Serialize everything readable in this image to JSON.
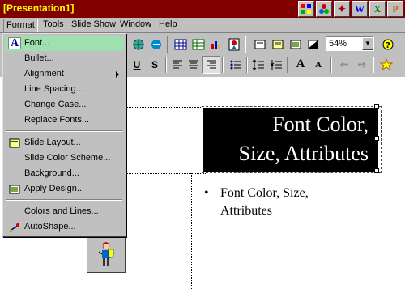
{
  "window": {
    "title": "[Presentation1]"
  },
  "office_bar": [
    "W",
    "X",
    "P"
  ],
  "menubar": {
    "items": [
      "Format",
      "Tools",
      "Slide Show",
      "Window",
      "Help"
    ]
  },
  "toolbar": {
    "zoom_value": "54%",
    "buttons": [
      "U",
      "S",
      "A",
      "A"
    ]
  },
  "format_menu": {
    "items": [
      {
        "label": "Font...",
        "icon": "font-icon"
      },
      {
        "label": "Bullet...",
        "icon": ""
      },
      {
        "label": "Alignment",
        "icon": ""
      },
      {
        "label": "Line Spacing...",
        "icon": ""
      },
      {
        "label": "Change Case...",
        "icon": ""
      },
      {
        "label": "Replace Fonts...",
        "icon": ""
      },
      {
        "label": "Slide Layout...",
        "icon": "slide-layout-icon"
      },
      {
        "label": "Slide Color Scheme...",
        "icon": ""
      },
      {
        "label": "Background...",
        "icon": ""
      },
      {
        "label": "Apply Design...",
        "icon": "apply-design-icon"
      },
      {
        "label": "Colors and Lines...",
        "icon": ""
      },
      {
        "label": "AutoShape...",
        "icon": "autoshape-icon"
      }
    ]
  },
  "slide": {
    "title_line1": "Font Color,",
    "title_line2": "Size, Attributes",
    "bullet_symbol": "•",
    "bullet_text": "Font Color, Size, Attributes"
  },
  "colors": {
    "titlebar": "#800000",
    "title_text": "#ffff00",
    "menu_highlight": "#a0e0b0",
    "title_box": "#000000"
  }
}
